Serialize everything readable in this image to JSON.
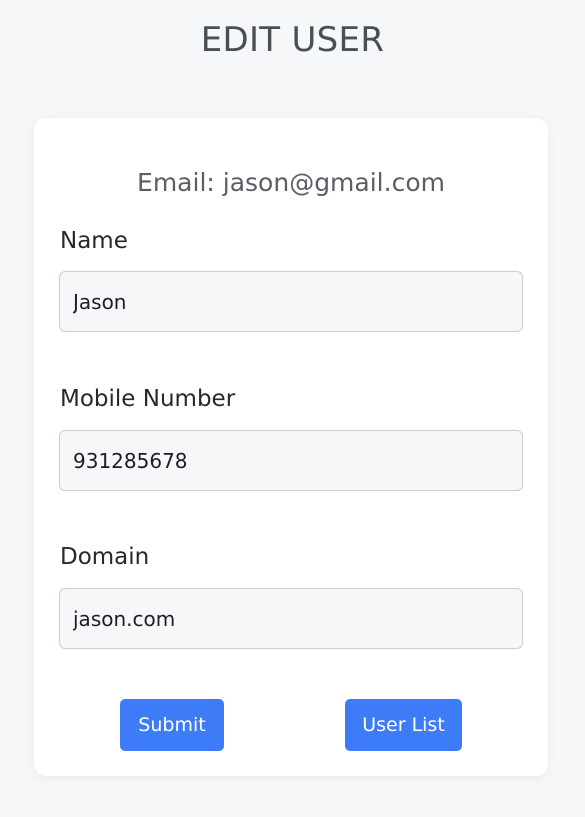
{
  "page": {
    "title": "EDIT USER"
  },
  "form": {
    "email_text": "Email: jason@gmail.com",
    "fields": [
      {
        "label": "Name",
        "value": "Jason"
      },
      {
        "label": "Mobile Number",
        "value": "931285678"
      },
      {
        "label": "Domain",
        "value": "jason.com"
      }
    ],
    "submit_label": "Submit",
    "user_list_label": "User List"
  },
  "colors": {
    "background": "#f6f7f9",
    "card": "#ffffff",
    "primary_button": "#3d7bf7",
    "input_background": "#f6f7f9",
    "input_border": "#ccced2"
  }
}
